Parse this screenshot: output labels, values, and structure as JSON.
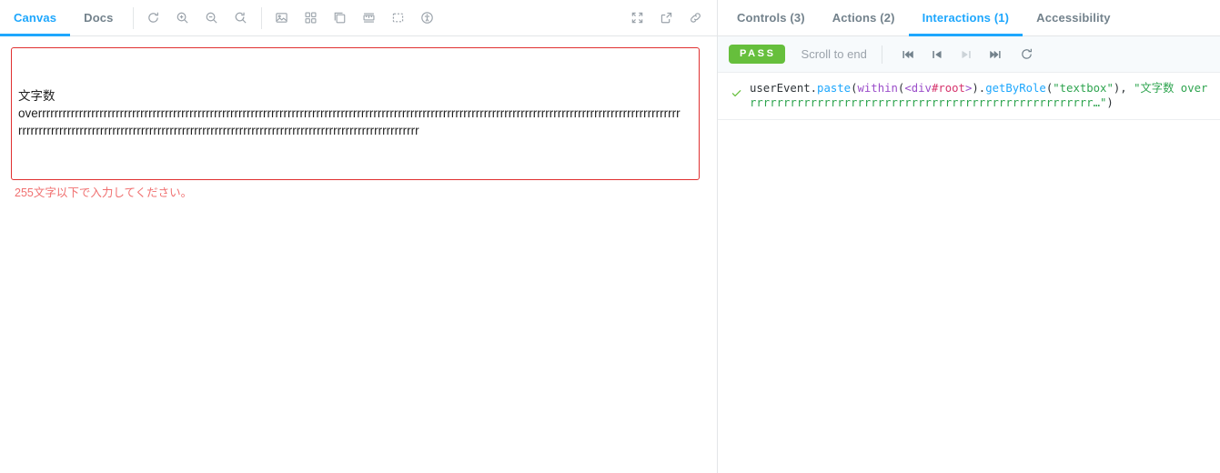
{
  "preview": {
    "tabs": [
      {
        "label": "Canvas",
        "name": "tab-canvas",
        "active": true
      },
      {
        "label": "Docs",
        "name": "tab-docs",
        "active": false
      }
    ],
    "toolbar_icons_left": [
      "remount-icon",
      "zoom-in-icon",
      "zoom-out-icon",
      "zoom-reset-icon",
      "background-image-icon",
      "grid-icon",
      "outline-icon",
      "measure-icon",
      "focus-box-icon",
      "accessibility-icon"
    ],
    "toolbar_icons_right": [
      "fullscreen-icon",
      "open-new-tab-icon",
      "copy-link-icon"
    ]
  },
  "story": {
    "textarea_label_line": "文字数",
    "textarea_value_line2": "overrrrrrrrrrrrrrrrrrrrrrrrrrrrrrrrrrrrrrrrrrrrrrrrrrrrrrrrrrrrrrrrrrrrrrrrrrrrrrrrrrrrrrrrrrrrrrrrrrrrrrrrrrrrrrrrrrrrrrrrrrrrrrrrrrrrrrrrrrrrrrrrrrrrrrrrrrrrr",
    "textarea_value_line3": "rrrrrrrrrrrrrrrrrrrrrrrrrrrrrrrrrrrrrrrrrrrrrrrrrrrrrrrrrrrrrrrrrrrrrrrrrrrrrrrrrrrrrrrrrrrrrrrrrr",
    "error_message": "255文字以下で入力してください。",
    "error_color": "#f07070",
    "border_error_color": "#e03030"
  },
  "addon_panel": {
    "tabs": [
      {
        "label": "Controls (3)",
        "name": "tab-controls",
        "active": false
      },
      {
        "label": "Actions (2)",
        "name": "tab-actions",
        "active": false
      },
      {
        "label": "Interactions (1)",
        "name": "tab-interactions",
        "active": true
      },
      {
        "label": "Accessibility",
        "name": "tab-accessibility",
        "active": false
      }
    ],
    "accent_color": "#1ea7fd"
  },
  "interactions": {
    "status_label": "PASS",
    "status_color": "#66bf3c",
    "scroll_to_end_label": "Scroll to end",
    "controls": [
      {
        "name": "go-to-start-button",
        "disabled": false
      },
      {
        "name": "step-back-button",
        "disabled": false
      },
      {
        "name": "step-forward-button",
        "disabled": true
      },
      {
        "name": "go-to-end-button",
        "disabled": false
      },
      {
        "name": "rerun-button",
        "disabled": false
      }
    ],
    "rows": [
      {
        "status_icon": "check-icon",
        "tokens": [
          {
            "t": "userEvent",
            "c": "tk-punc"
          },
          {
            "t": ".",
            "c": "tk-punc"
          },
          {
            "t": "paste",
            "c": "tk-fn"
          },
          {
            "t": "(",
            "c": "tk-punc"
          },
          {
            "t": "within",
            "c": "tk-kw"
          },
          {
            "t": "(",
            "c": "tk-punc"
          },
          {
            "t": "<div",
            "c": "tk-tag"
          },
          {
            "t": "#root",
            "c": "tk-id"
          },
          {
            "t": ">",
            "c": "tk-tag"
          },
          {
            "t": ")",
            "c": "tk-punc"
          },
          {
            "t": ".",
            "c": "tk-punc"
          },
          {
            "t": "getByRole",
            "c": "tk-fn"
          },
          {
            "t": "(",
            "c": "tk-punc"
          },
          {
            "t": "\"textbox\"",
            "c": "tk-str"
          },
          {
            "t": ")",
            "c": "tk-punc"
          },
          {
            "t": ", ",
            "c": "tk-punc"
          },
          {
            "t": "\"文字数 overrrrrrrrrrrrrrrrrrrrrrrrrrrrrrrrrrrrrrrrrrrrrrrrrrrr…\"",
            "c": "tk-str"
          },
          {
            "t": ")",
            "c": "tk-punc"
          }
        ]
      }
    ]
  }
}
